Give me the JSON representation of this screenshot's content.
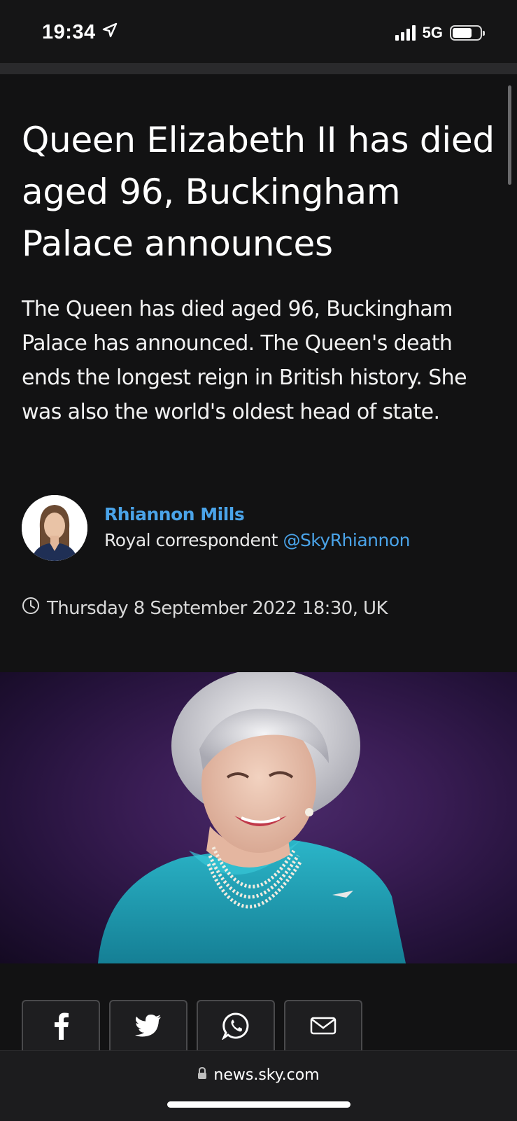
{
  "status_bar": {
    "time": "19:34",
    "network": "5G",
    "battery_level": 0.7,
    "icons": [
      "location-arrow-icon",
      "signal-icon",
      "battery-icon"
    ]
  },
  "article": {
    "headline": "Queen Elizabeth II has died aged 96, Buckingham Palace announces",
    "standfirst": "The Queen has died aged 96, Buckingham Palace has announced. The Queen's death ends the longest reign in British history. She was also the world's oldest head of state.",
    "author": {
      "name": "Rhiannon Mills",
      "role": "Royal correspondent",
      "handle": "@SkyRhiannon"
    },
    "timestamp": "Thursday 8 September 2022 18:30, UK"
  },
  "share": {
    "buttons": [
      {
        "icon": "facebook-icon"
      },
      {
        "icon": "twitter-icon"
      },
      {
        "icon": "whatsapp-icon"
      },
      {
        "icon": "email-icon"
      }
    ]
  },
  "browser": {
    "url": "news.sky.com"
  },
  "colors": {
    "background": "#121213",
    "link_blue": "#4aa3e8",
    "hero_purple": "#3a1d55"
  }
}
